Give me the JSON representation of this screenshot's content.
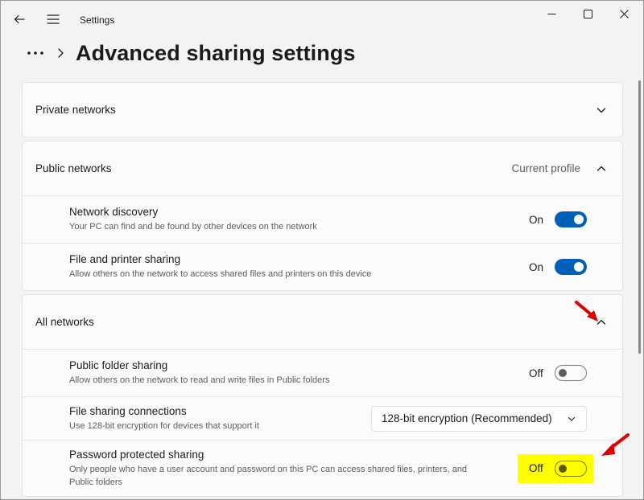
{
  "window": {
    "app_title": "Settings"
  },
  "breadcrumb": {
    "ellipsis": "•••",
    "page_title": "Advanced sharing settings"
  },
  "sections": {
    "private": {
      "label": "Private networks"
    },
    "public": {
      "label": "Public networks",
      "badge": "Current profile",
      "rows": [
        {
          "title": "Network discovery",
          "desc": "Your PC can find and be found by other devices on the network",
          "state": "On"
        },
        {
          "title": "File and printer sharing",
          "desc": "Allow others on the network to access shared files and printers on this device",
          "state": "On"
        }
      ]
    },
    "all": {
      "label": "All networks",
      "public_folder": {
        "title": "Public folder sharing",
        "desc": "Allow others on the network to read and write files in Public folders",
        "state": "Off"
      },
      "file_sharing": {
        "title": "File sharing connections",
        "desc": "Use 128-bit encryption for devices that support it",
        "selected": "128-bit encryption (Recommended)"
      },
      "password": {
        "title": "Password protected sharing",
        "desc_line1": "Only people who have a user account and password on this PC can access shared files, printers, and",
        "desc_line2": "Public folders",
        "state": "Off"
      }
    }
  },
  "colors": {
    "accent": "#005fb8",
    "highlight": "#ffff00",
    "annotation_arrow": "#e00000"
  }
}
